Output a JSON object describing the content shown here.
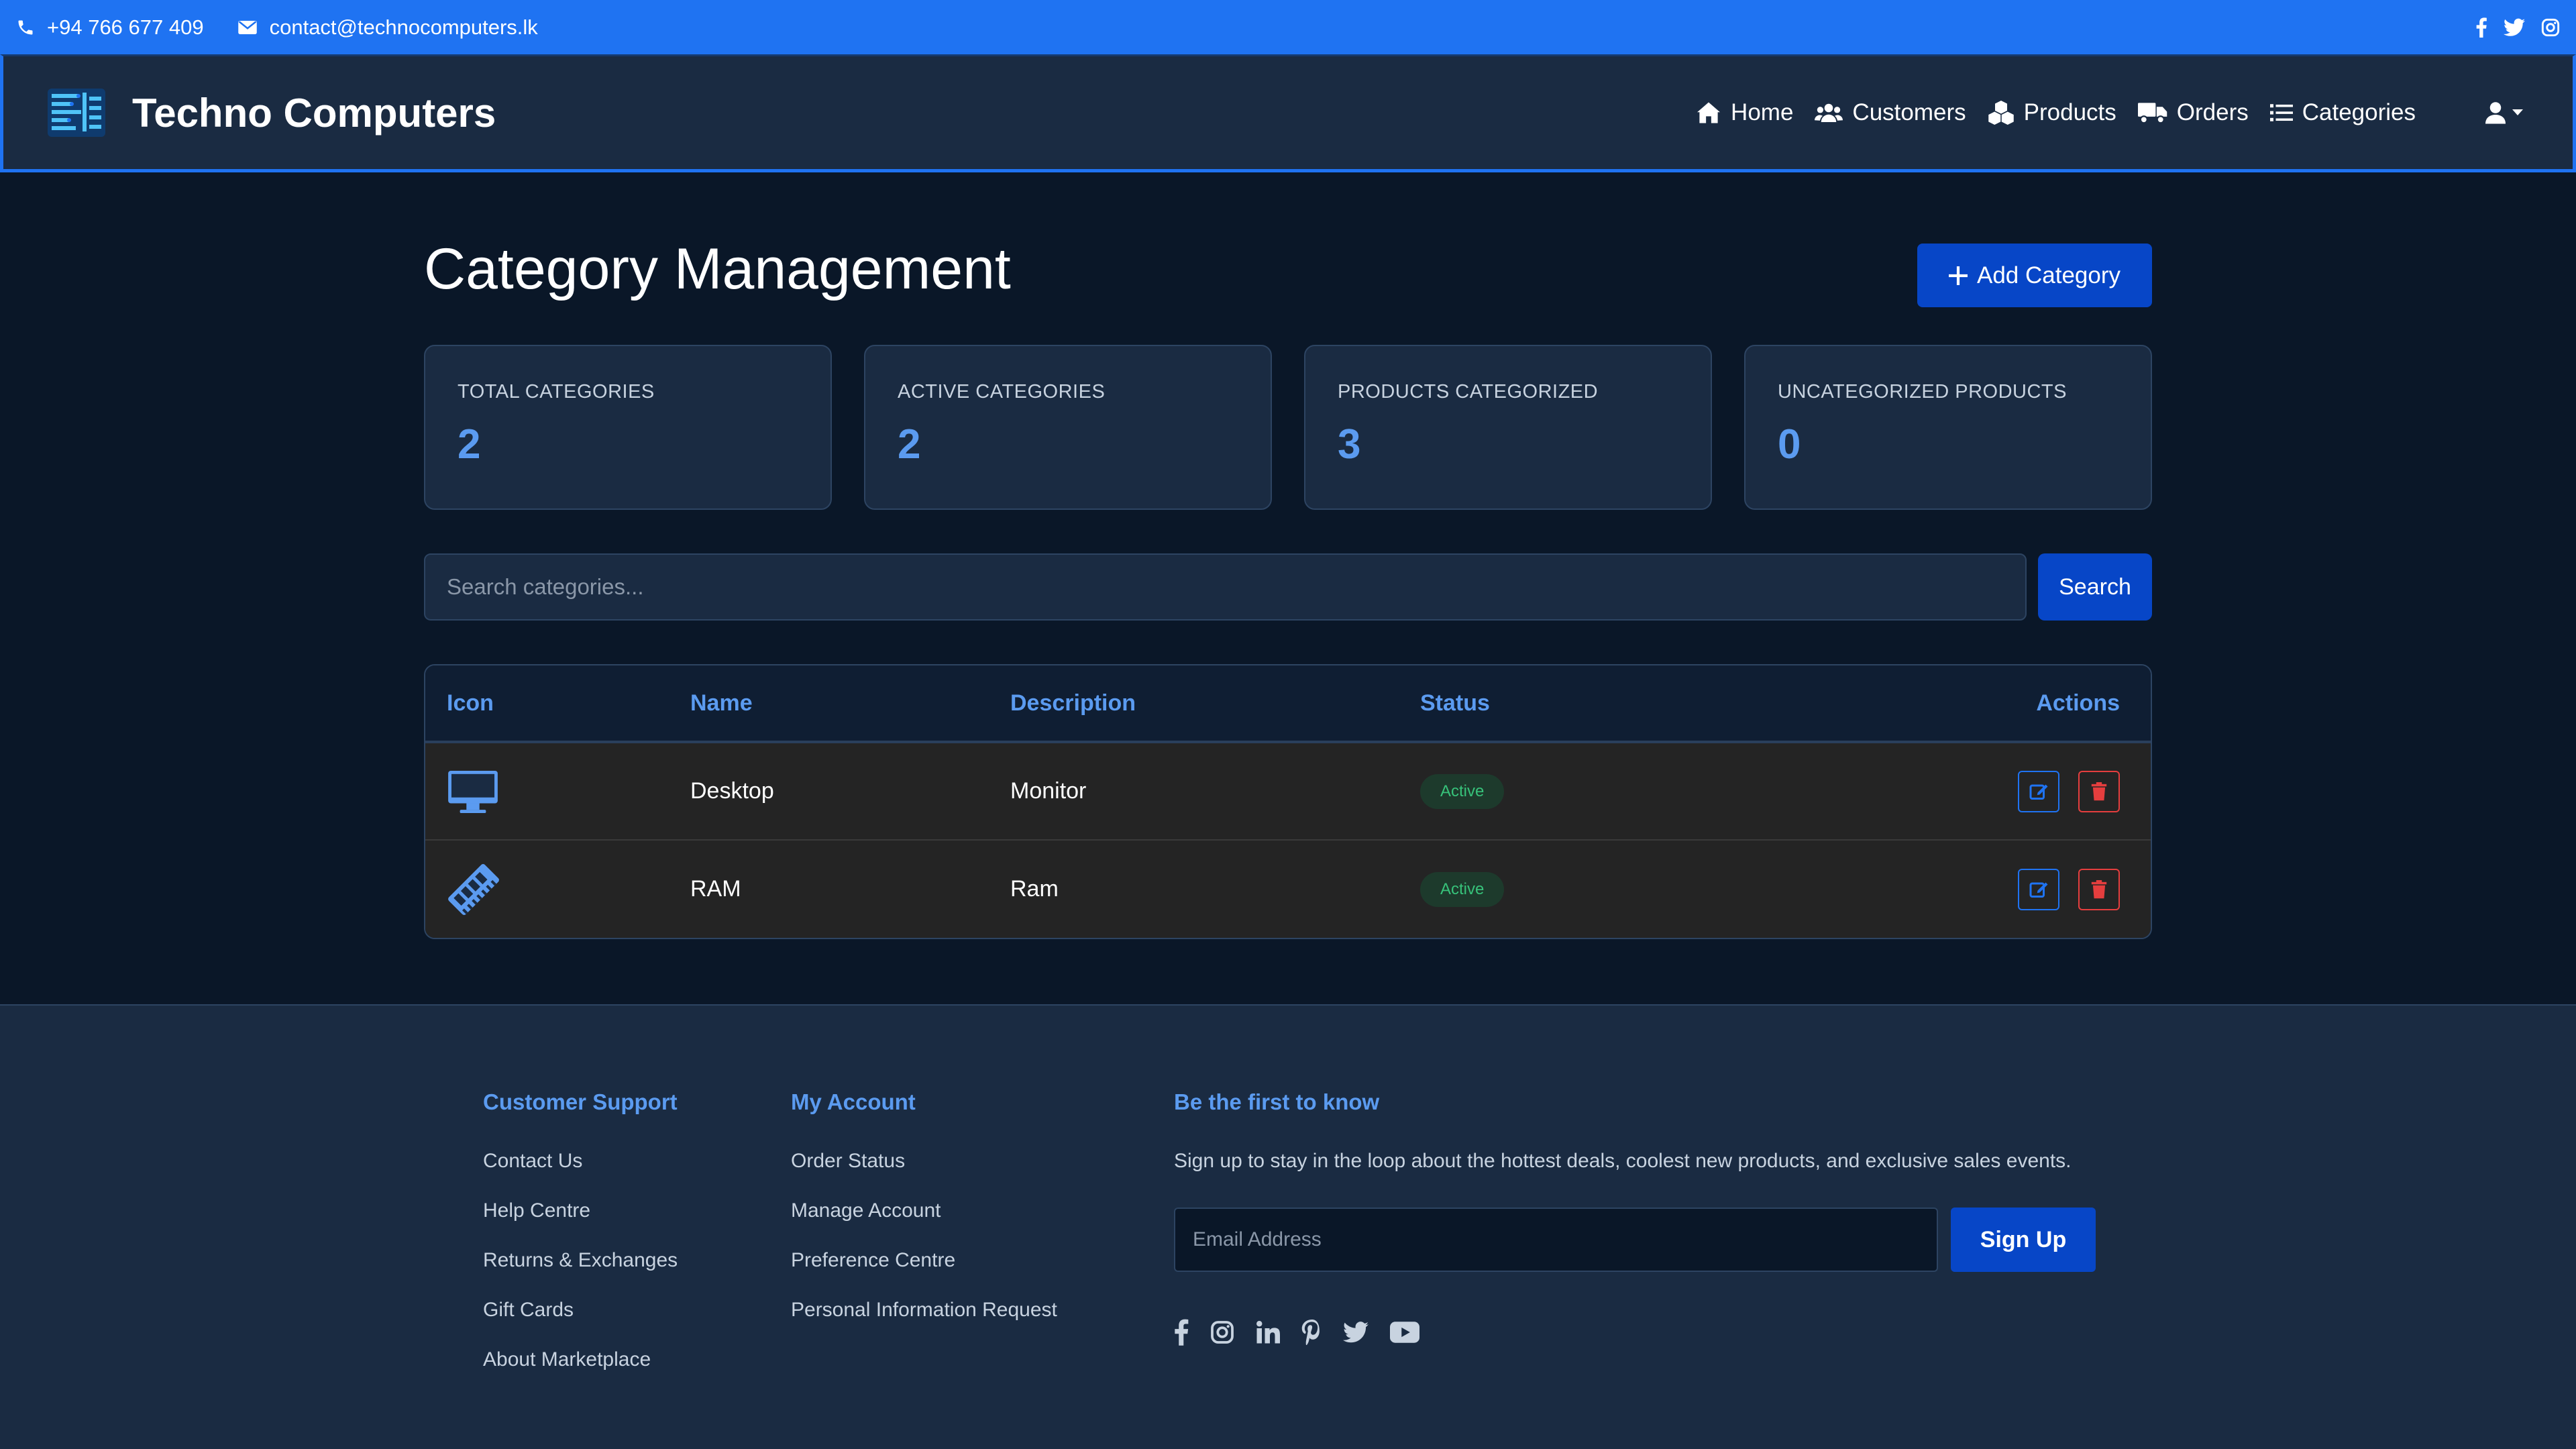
{
  "topbar": {
    "phone": "+94 766 677 409",
    "email": "contact@technocomputers.lk",
    "social_icons": [
      "facebook-icon",
      "twitter-icon",
      "instagram-icon"
    ]
  },
  "navbar": {
    "brand": "Techno Computers",
    "items": [
      {
        "label": "Home",
        "icon": "home-icon"
      },
      {
        "label": "Customers",
        "icon": "users-icon"
      },
      {
        "label": "Products",
        "icon": "cubes-icon"
      },
      {
        "label": "Orders",
        "icon": "truck-icon"
      },
      {
        "label": "Categories",
        "icon": "list-icon"
      }
    ]
  },
  "page": {
    "title": "Category Management",
    "add_button": "Add Category"
  },
  "stats": [
    {
      "label": "TOTAL CATEGORIES",
      "value": "2"
    },
    {
      "label": "ACTIVE CATEGORIES",
      "value": "2"
    },
    {
      "label": "PRODUCTS CATEGORIZED",
      "value": "3"
    },
    {
      "label": "UNCATEGORIZED PRODUCTS",
      "value": "0"
    }
  ],
  "search": {
    "placeholder": "Search categories...",
    "button": "Search"
  },
  "table": {
    "headers": {
      "icon": "Icon",
      "name": "Name",
      "description": "Description",
      "status": "Status",
      "actions": "Actions"
    },
    "rows": [
      {
        "icon": "desktop-icon",
        "name": "Desktop",
        "description": "Monitor",
        "status": "Active"
      },
      {
        "icon": "memory-icon",
        "name": "RAM",
        "description": "Ram",
        "status": "Active"
      }
    ]
  },
  "footer": {
    "support": {
      "heading": "Customer Support",
      "links": [
        "Contact Us",
        "Help Centre",
        "Returns & Exchanges",
        "Gift Cards",
        "About Marketplace"
      ]
    },
    "account": {
      "heading": "My Account",
      "links": [
        "Order Status",
        "Manage Account",
        "Preference Centre",
        "Personal Information Request"
      ]
    },
    "newsletter": {
      "heading": "Be the first to know",
      "text": "Sign up to stay in the loop about the hottest deals, coolest new products, and exclusive sales events.",
      "placeholder": "Email Address",
      "button": "Sign Up"
    },
    "social_icons": [
      "facebook-icon",
      "instagram-icon",
      "linkedin-icon",
      "pinterest-icon",
      "twitter-icon",
      "youtube-icon"
    ]
  },
  "colors": {
    "accent": "#1f73f2",
    "primary_button": "#0746c7",
    "background": "#0a1728",
    "panel": "#1a2b42",
    "stat_value": "#5b9bf0",
    "active_badge": "#37c27a",
    "danger": "#e53e3e"
  }
}
